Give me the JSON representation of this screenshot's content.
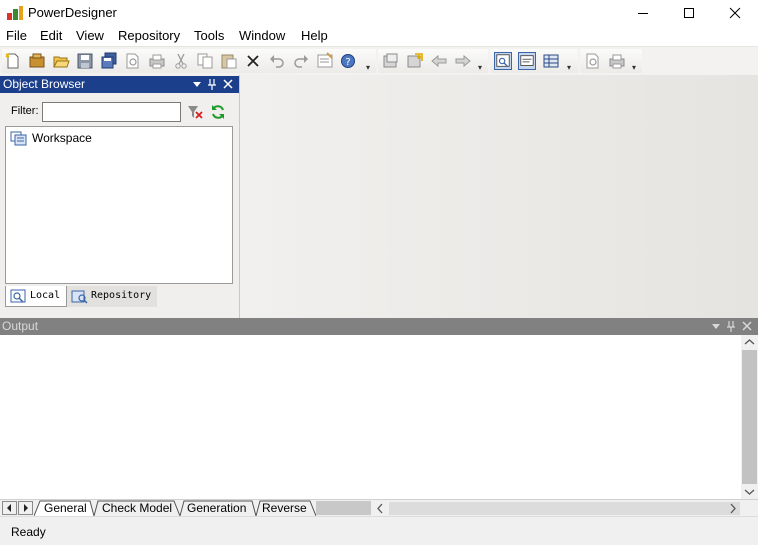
{
  "window": {
    "title": "PowerDesigner"
  },
  "menubar": {
    "items": [
      "File",
      "Edit",
      "View",
      "Repository",
      "Tools",
      "Window",
      "Help"
    ]
  },
  "toolbar": {
    "icons": [
      "new-icon",
      "open-project-icon",
      "open-icon",
      "save-icon",
      "save-all-icon",
      "print-preview-icon",
      "print-icon",
      "cut-icon",
      "copy-icon",
      "paste-icon",
      "delete-icon",
      "undo-icon",
      "redo-icon",
      "properties-icon",
      "help-icon",
      "check-in-icon",
      "check-out-icon",
      "back-icon",
      "forward-icon",
      "object-browser-icon",
      "output-icon",
      "result-list-icon",
      "find-icon",
      "print-setup-icon"
    ]
  },
  "object_browser": {
    "title": "Object Browser",
    "filter_label": "Filter:",
    "filter_value": "",
    "tree": [
      {
        "label": "Workspace",
        "icon": "workspace-icon"
      }
    ],
    "tabs": [
      {
        "label": "Local",
        "icon": "local-icon"
      },
      {
        "label": "Repository",
        "icon": "repository-icon"
      }
    ]
  },
  "output": {
    "title": "Output",
    "tabs": [
      "General",
      "Check Model",
      "Generation",
      "Reverse"
    ]
  },
  "status": {
    "text": "Ready"
  },
  "colors": {
    "object_browser_header": "#1c3f8c",
    "output_header": "#818181",
    "workspace_background": "#e8e6e2"
  }
}
